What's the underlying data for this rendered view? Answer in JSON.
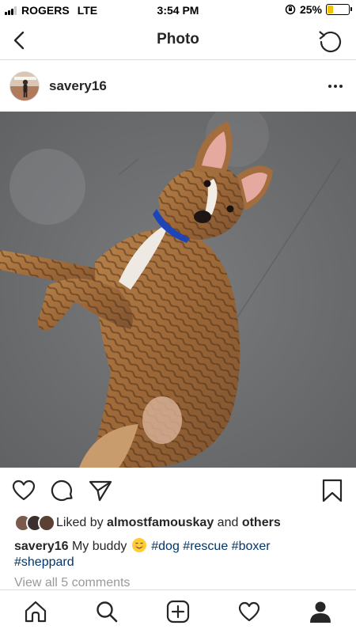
{
  "status_bar": {
    "carrier": "ROGERS",
    "network": "LTE",
    "time": "3:54 PM",
    "battery_percent": "25%",
    "battery_level": 0.25,
    "battery_color": "#f2c200"
  },
  "nav": {
    "title": "Photo",
    "back_icon": "chevron-left-icon",
    "refresh_icon": "refresh-icon"
  },
  "post": {
    "username": "savery16",
    "more_icon": "more-horizontal-icon",
    "photo_description_icon": "photo"
  },
  "actions": {
    "like_icon": "heart-icon",
    "comment_icon": "comment-icon",
    "share_icon": "send-icon",
    "save_icon": "bookmark-icon"
  },
  "likes": {
    "prefix": "Liked by",
    "user": "almostfamouskay",
    "conjunction": "and",
    "others": "others"
  },
  "caption": {
    "username": "savery16",
    "text": "My buddy",
    "hashtags": [
      "#dog",
      "#rescue",
      "#boxer",
      "#sheppard"
    ]
  },
  "comments": {
    "view_all": "View all 5 comments"
  },
  "tab_bar": {
    "items": [
      "home-icon",
      "search-icon",
      "add-post-icon",
      "activity-heart-icon",
      "profile-icon"
    ]
  },
  "colors": {
    "text": "#262626",
    "hashtag": "#003569",
    "muted": "#999999",
    "divider": "#dbdbdb"
  }
}
